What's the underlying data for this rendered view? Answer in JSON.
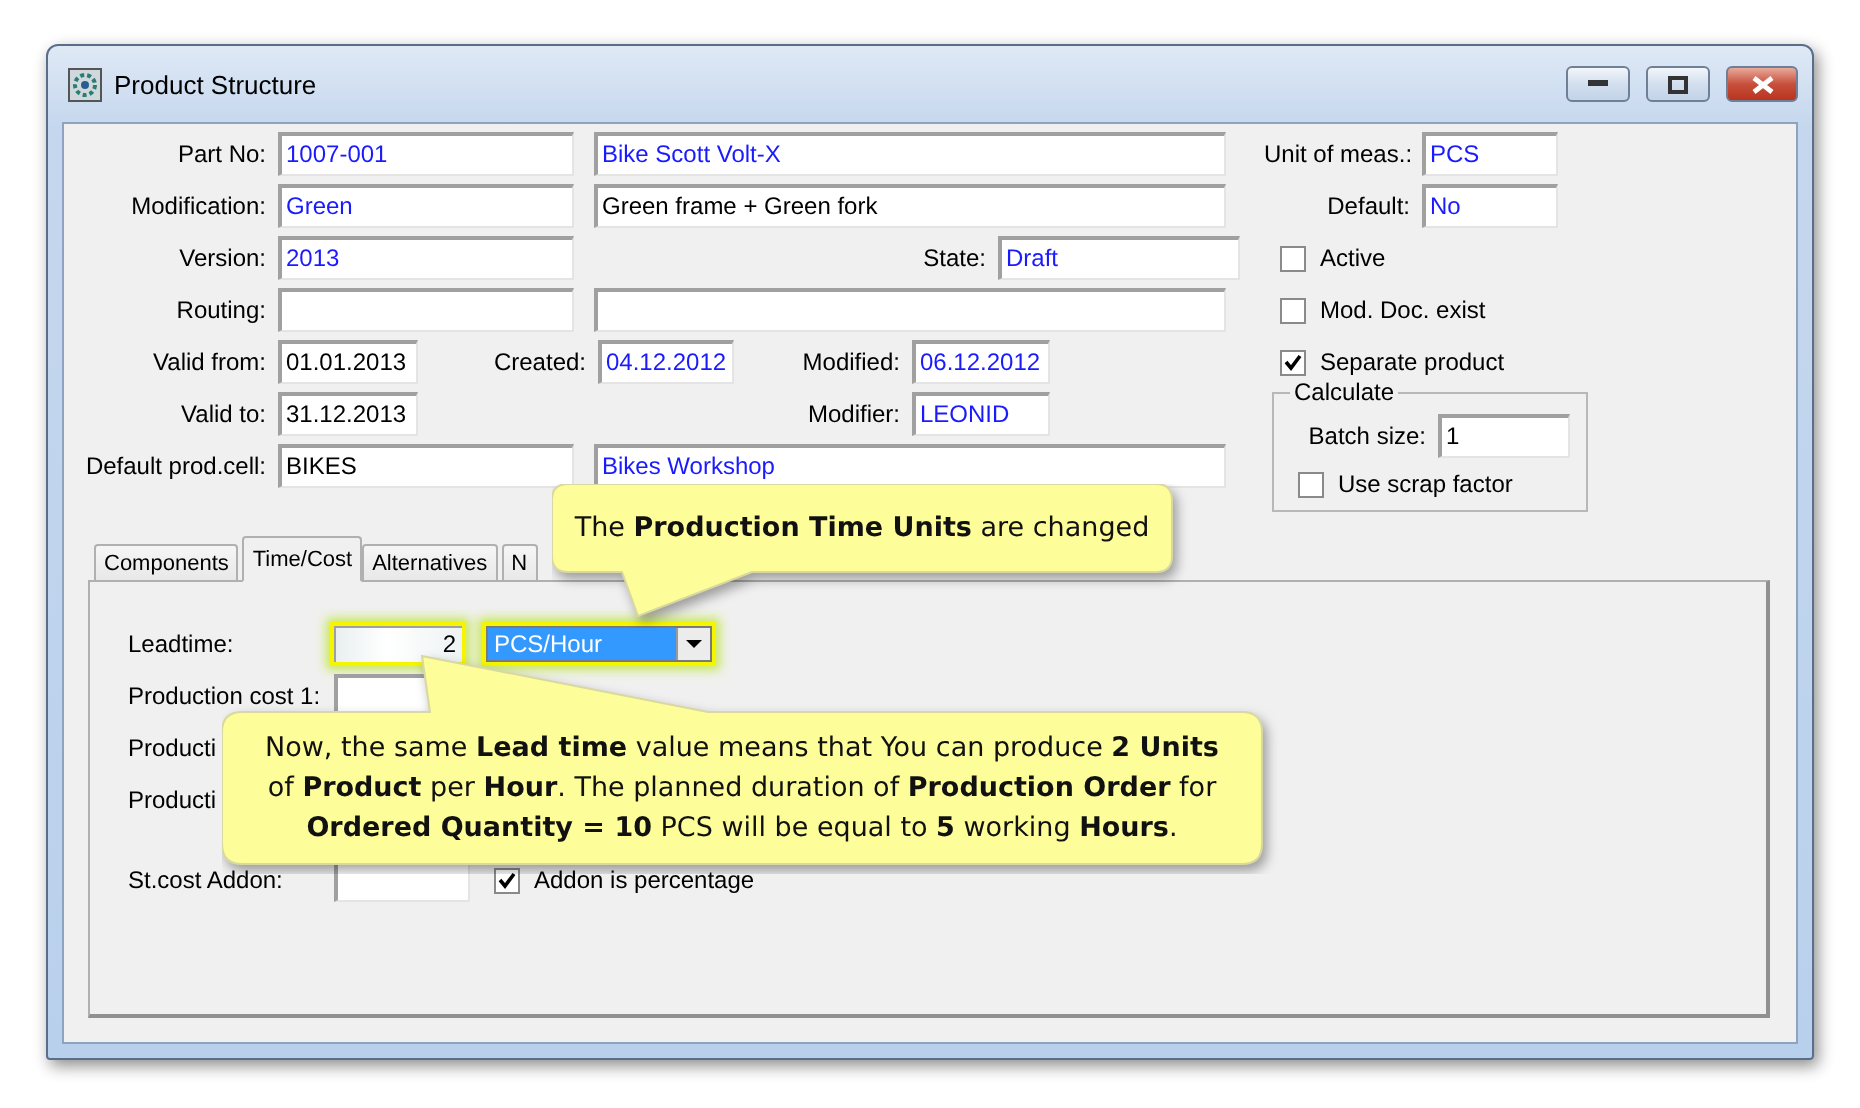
{
  "window": {
    "title": "Product Structure"
  },
  "fields": {
    "part_no": {
      "label": "Part No:",
      "value": "1007-001",
      "color": "#1a1aff"
    },
    "part_name": {
      "value": "Bike Scott Volt-X",
      "color": "#1a1aff"
    },
    "modification": {
      "label": "Modification:",
      "value": "Green",
      "color": "#1a1aff"
    },
    "modification_text": {
      "value": "Green frame + Green fork",
      "color": "#000000"
    },
    "version": {
      "label": "Version:",
      "value": "2013",
      "color": "#1a1aff"
    },
    "state": {
      "label": "State:",
      "value": "Draft",
      "color": "#1a1aff"
    },
    "routing": {
      "label": "Routing:"
    },
    "valid_from": {
      "label": "Valid from:",
      "value": "01.01.2013",
      "color": "#000000"
    },
    "created": {
      "label": "Created:",
      "value": "04.12.2012",
      "color": "#1a1aff"
    },
    "modified": {
      "label": "Modified:",
      "value": "06.12.2012",
      "color": "#1a1aff"
    },
    "valid_to": {
      "label": "Valid to:",
      "value": "31.12.2013",
      "color": "#000000"
    },
    "modifier": {
      "label": "Modifier:",
      "value": "LEONID",
      "color": "#1a1aff"
    },
    "prod_cell": {
      "label": "Default prod.cell:",
      "value": "BIKES",
      "color": "#000000"
    },
    "prod_cell_name": {
      "value": "Bikes Workshop",
      "color": "#1a1aff"
    },
    "unit": {
      "label": "Unit of meas.:",
      "value": "PCS",
      "color": "#1a1aff"
    },
    "default": {
      "label": "Default:",
      "value": "No",
      "color": "#1a1aff"
    }
  },
  "options": [
    {
      "label": "Active",
      "checked": false
    },
    {
      "label": "Mod. Doc. exist",
      "checked": false
    },
    {
      "label": "Separate product",
      "checked": true
    }
  ],
  "calculate": {
    "title": "Calculate",
    "batch_label": "Batch size:",
    "batch_value": "1",
    "scrap": {
      "label": "Use scrap factor",
      "checked": false
    }
  },
  "tabs": [
    {
      "label": "Components",
      "selected": false
    },
    {
      "label": "Time/Cost",
      "selected": true
    },
    {
      "label": "Alternatives",
      "selected": false
    },
    {
      "label": "N",
      "selected": false
    }
  ],
  "time_cost": {
    "leadtime": {
      "label": "Leadtime:",
      "value": "2",
      "unit": "PCS/Hour",
      "highlighted": true
    },
    "costs": [
      {
        "label": "Production cost 1:"
      },
      {
        "label": "Producti"
      },
      {
        "label": "Producti"
      }
    ],
    "addon": {
      "label": "St.cost Addon:"
    },
    "addon_percentage": {
      "label": "Addon is percentage",
      "checked": true
    }
  },
  "callouts": [
    {
      "text": "The **Production Time Units** are changed"
    },
    {
      "text": "Now, the same **Lead time** value means that You can produce **2 Units** of **Product** per **Hour**.  The planned duration of **Production Order** for **Ordered Quantity = 10** PCS will be equal to **5** working **Hours**."
    }
  ]
}
